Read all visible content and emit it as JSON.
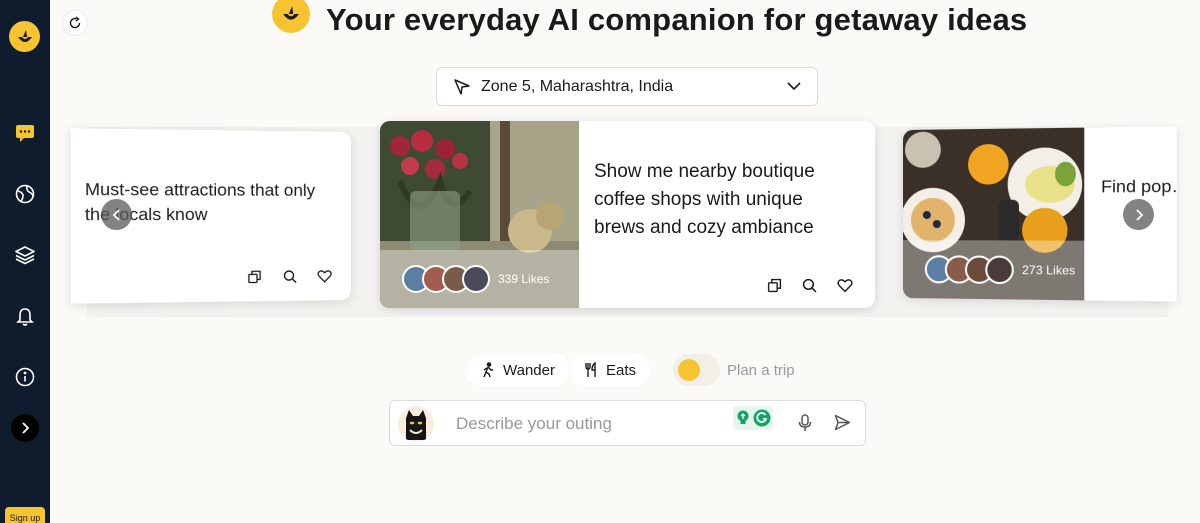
{
  "app": {
    "title": "Your everyday AI companion for getaway ideas",
    "accent_color": "#f7c431",
    "sidebar_color": "#0f1c2e"
  },
  "sidebar": {
    "items": [
      {
        "icon": "chat-bubble-icon"
      },
      {
        "icon": "globe-icon"
      },
      {
        "icon": "layers-icon"
      },
      {
        "icon": "bell-icon"
      },
      {
        "icon": "info-icon"
      }
    ],
    "expand_icon": "chevron-right-icon",
    "signup_label": "Sign up"
  },
  "location": {
    "value": "Zone 5, Maharashtra, India",
    "icon": "navigation-arrow-icon"
  },
  "cards": [
    {
      "text": "Must-see attractions that only the locals know"
    },
    {
      "text": "Show me nearby boutique coffee shops with unique brews and cozy ambiance",
      "likes": "339 Likes"
    },
    {
      "text": "Find pop… nearby",
      "likes": "273 Likes"
    }
  ],
  "modes": {
    "wander": "Wander",
    "eats": "Eats",
    "plan": "Plan a trip"
  },
  "input": {
    "placeholder": "Describe your outing"
  }
}
